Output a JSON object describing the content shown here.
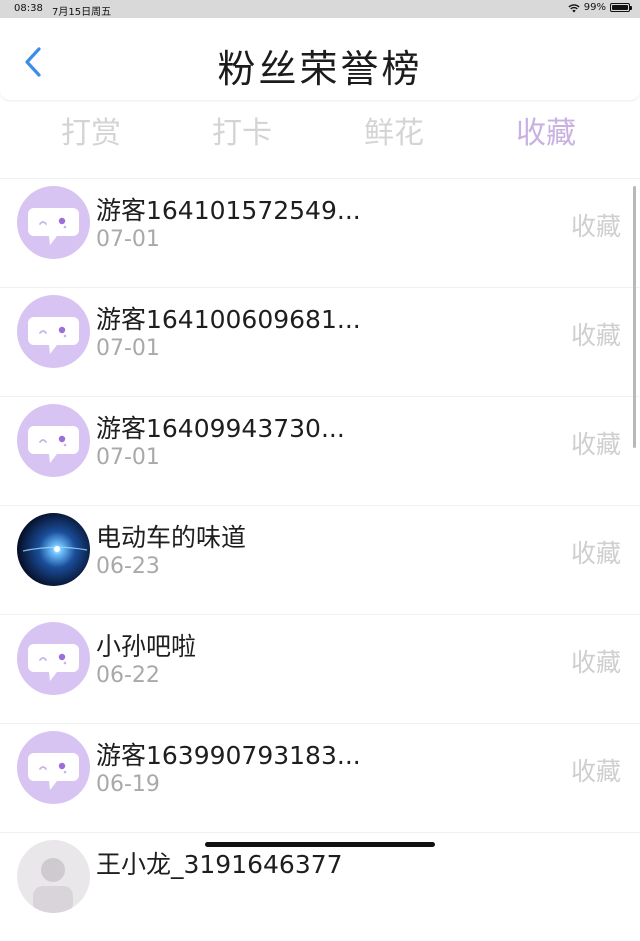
{
  "status_bar": {
    "time": "08:38",
    "date": "7月15日周五",
    "battery": "99%",
    "battery_level": 0.99
  },
  "header": {
    "title": "粉丝荣誉榜",
    "back_icon": "chevron-left-icon"
  },
  "tabs": [
    {
      "label": "打赏",
      "active": false
    },
    {
      "label": "打卡",
      "active": false
    },
    {
      "label": "鲜花",
      "active": false
    },
    {
      "label": "收藏",
      "active": true
    }
  ],
  "colors": {
    "accent": "#c9b2e3",
    "back_icon": "#3a8ee6",
    "avatar_default": "#d7c4f3",
    "muted_text": "#a9a9a9"
  },
  "fans": [
    {
      "name": "游客164101572549...",
      "date": "07-01",
      "action": "收藏",
      "avatar": "default-chat-avatar"
    },
    {
      "name": "游客164100609681...",
      "date": "07-01",
      "action": "收藏",
      "avatar": "default-chat-avatar"
    },
    {
      "name": "游客16409943730...",
      "date": "07-01",
      "action": "收藏",
      "avatar": "default-chat-avatar"
    },
    {
      "name": "电动车的味道",
      "date": "06-23",
      "action": "收藏",
      "avatar": "space-light-photo-avatar"
    },
    {
      "name": "小孙吧啦",
      "date": "06-22",
      "action": "收藏",
      "avatar": "default-chat-avatar"
    },
    {
      "name": "游客163990793183...",
      "date": "06-19",
      "action": "收藏",
      "avatar": "default-chat-avatar"
    },
    {
      "name": "王小龙_3191646377",
      "date": "",
      "action": "",
      "avatar": "photo-avatar"
    }
  ]
}
